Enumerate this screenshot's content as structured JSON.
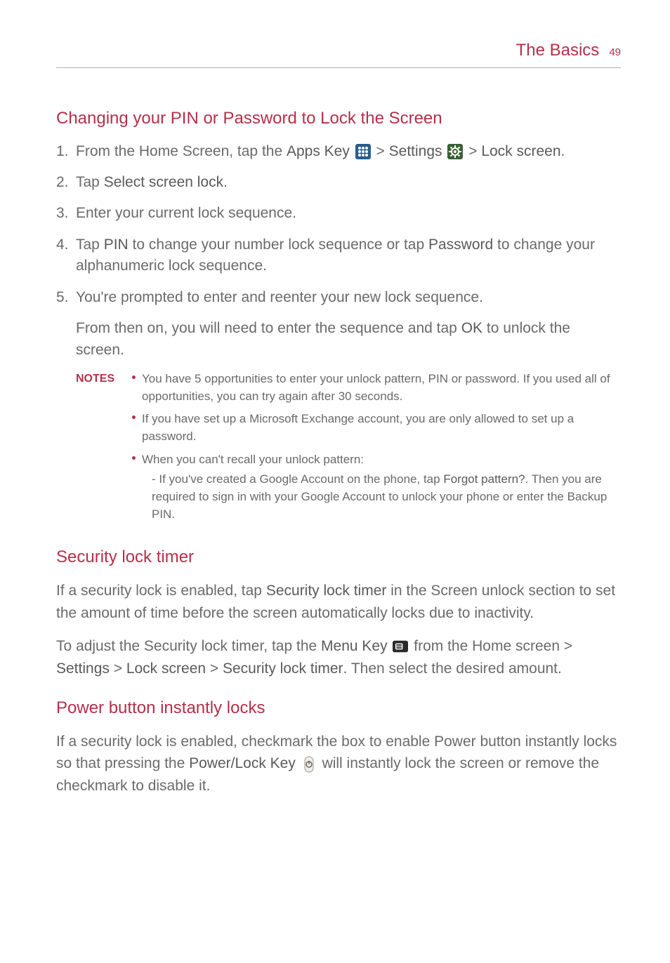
{
  "header": {
    "title": "The Basics",
    "page_number": "49"
  },
  "sections": {
    "s1": {
      "title": "Changing your PIN or Password to Lock the Screen",
      "list": {
        "i1": {
          "n": "1.",
          "t1": "From the Home Screen, tap the ",
          "b1": "Apps Key",
          "t2": " > ",
          "b2": "Settings",
          "t3": " > ",
          "b3": "Lock screen",
          "t4": "."
        },
        "i2": {
          "n": "2.",
          "t1": "Tap ",
          "b1": "Select screen lock",
          "t2": "."
        },
        "i3": {
          "n": "3.",
          "t1": "Enter your current lock sequence."
        },
        "i4": {
          "n": "4.",
          "t1": "Tap ",
          "b1": "PIN",
          "t2": " to change your number lock sequence or tap ",
          "b2": "Password",
          "t3": " to change your alphanumeric lock sequence."
        },
        "i5": {
          "n": "5.",
          "t1": "You're prompted to enter and reenter your new lock sequence."
        }
      },
      "continuation": {
        "t1": "From then on, you will need to enter the sequence and tap ",
        "b1": "OK",
        "t2": " to unlock the screen."
      },
      "notes_label": "NOTES",
      "notes": {
        "n1": "You have 5 opportunities to enter your unlock pattern, PIN or password. If you used all of opportunities, you can try again after 30 seconds.",
        "n2": "If you have set up a Microsoft Exchange account, you are only allowed to set up a password.",
        "n3": "When you can't recall your unlock pattern:",
        "n3_sub_pre": "- If you've created a Google Account on the phone, tap ",
        "n3_sub_b": "Forgot pattern?",
        "n3_sub_post": ". Then you are required to sign in with your Google Account to unlock your phone or enter the Backup PIN."
      }
    },
    "s2": {
      "title": "Security lock timer",
      "p1": {
        "t1": "If a security lock is enabled, tap ",
        "b1": "Security lock timer",
        "t2": " in the Screen unlock section to set the amount of time before the screen automatically locks due to inactivity."
      },
      "p2": {
        "t1": "To adjust the Security lock timer, tap the ",
        "b1": "Menu Key",
        "t2": " from the Home screen > ",
        "b2": "Settings",
        "t3": " > ",
        "b3": "Lock screen",
        "t4": " > ",
        "b4": "Security lock timer",
        "t5": ". Then select the desired amount."
      }
    },
    "s3": {
      "title": "Power button instantly locks",
      "p1": {
        "t1": "If a security lock is enabled, checkmark the box to enable Power button instantly locks so that pressing the ",
        "b1": "Power/Lock Key",
        "t2": " will instantly lock the screen or remove the checkmark to disable it."
      }
    }
  }
}
